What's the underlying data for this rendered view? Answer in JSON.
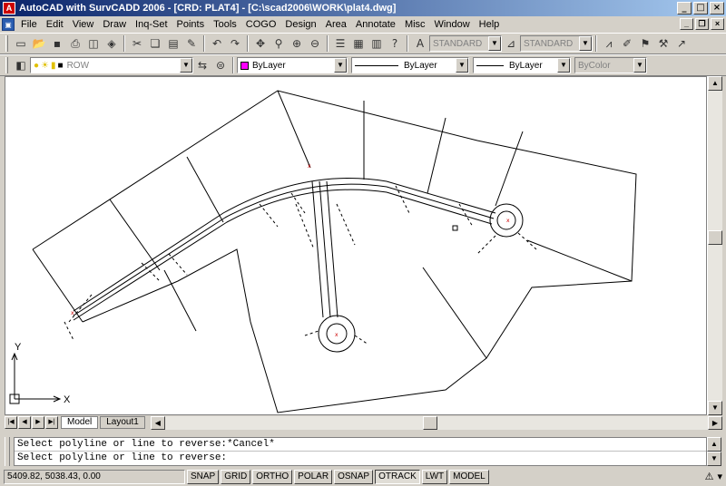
{
  "window": {
    "title": "AutoCAD with SurvCADD 2006 - [CRD: PLAT4] - [C:\\scad2006\\WORK\\plat4.dwg]",
    "min": "_",
    "max": "□",
    "close": "×"
  },
  "menu": [
    "File",
    "Edit",
    "View",
    "Draw",
    "Inq-Set",
    "Points",
    "Tools",
    "COGO",
    "Design",
    "Area",
    "Annotate",
    "Misc",
    "Window",
    "Help"
  ],
  "toolbar1": {
    "text_style": "STANDARD",
    "dim_style": "STANDARD"
  },
  "toolbar2": {
    "layer": "ROW",
    "color": "ByLayer",
    "linetype": "ByLayer",
    "lineweight": "ByLayer",
    "plotstyle": "ByColor"
  },
  "ucs": {
    "x_label": "X",
    "y_label": "Y"
  },
  "tabs": [
    "Model",
    "Layout1"
  ],
  "command": {
    "line1": "Select polyline or line to reverse:*Cancel*",
    "line2": "Select polyline or line to reverse:"
  },
  "status": {
    "coords": "5409.82, 5038.43, 0.00",
    "buttons": [
      {
        "label": "SNAP",
        "on": false
      },
      {
        "label": "GRID",
        "on": false
      },
      {
        "label": "ORTHO",
        "on": false
      },
      {
        "label": "POLAR",
        "on": false
      },
      {
        "label": "OSNAP",
        "on": false
      },
      {
        "label": "OTRACK",
        "on": true
      },
      {
        "label": "LWT",
        "on": false
      },
      {
        "label": "MODEL",
        "on": false
      }
    ]
  },
  "colors": {
    "titlebar_start": "#0a246a",
    "titlebar_end": "#a6caf0",
    "magenta_swatch": "#ff00ff"
  },
  "icons": [
    "new-icon",
    "open-icon",
    "save-icon",
    "print-icon",
    "preview-icon",
    "publish-icon",
    "cut-icon",
    "copy-icon",
    "paste-icon",
    "matchprop-icon",
    "undo-icon",
    "redo-icon",
    "pan-icon",
    "zoom-realtime-icon",
    "zoom-window-icon",
    "zoom-previous-icon",
    "properties-icon",
    "designcenter-icon",
    "toolpalettes-icon",
    "help-icon"
  ]
}
